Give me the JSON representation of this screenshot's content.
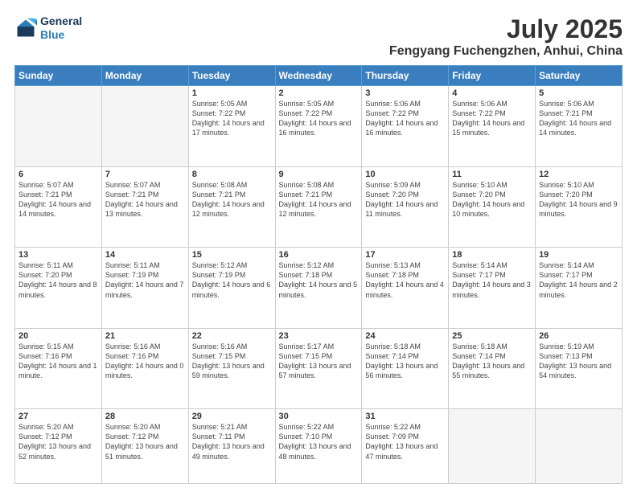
{
  "header": {
    "logo_line1": "General",
    "logo_line2": "Blue",
    "title": "July 2025",
    "subtitle": "Fengyang Fuchengzhen, Anhui, China"
  },
  "weekdays": [
    "Sunday",
    "Monday",
    "Tuesday",
    "Wednesday",
    "Thursday",
    "Friday",
    "Saturday"
  ],
  "weeks": [
    [
      {
        "day": "",
        "info": ""
      },
      {
        "day": "",
        "info": ""
      },
      {
        "day": "1",
        "info": "Sunrise: 5:05 AM\nSunset: 7:22 PM\nDaylight: 14 hours and 17 minutes."
      },
      {
        "day": "2",
        "info": "Sunrise: 5:05 AM\nSunset: 7:22 PM\nDaylight: 14 hours and 16 minutes."
      },
      {
        "day": "3",
        "info": "Sunrise: 5:06 AM\nSunset: 7:22 PM\nDaylight: 14 hours and 16 minutes."
      },
      {
        "day": "4",
        "info": "Sunrise: 5:06 AM\nSunset: 7:22 PM\nDaylight: 14 hours and 15 minutes."
      },
      {
        "day": "5",
        "info": "Sunrise: 5:06 AM\nSunset: 7:21 PM\nDaylight: 14 hours and 14 minutes."
      }
    ],
    [
      {
        "day": "6",
        "info": "Sunrise: 5:07 AM\nSunset: 7:21 PM\nDaylight: 14 hours and 14 minutes."
      },
      {
        "day": "7",
        "info": "Sunrise: 5:07 AM\nSunset: 7:21 PM\nDaylight: 14 hours and 13 minutes."
      },
      {
        "day": "8",
        "info": "Sunrise: 5:08 AM\nSunset: 7:21 PM\nDaylight: 14 hours and 12 minutes."
      },
      {
        "day": "9",
        "info": "Sunrise: 5:08 AM\nSunset: 7:21 PM\nDaylight: 14 hours and 12 minutes."
      },
      {
        "day": "10",
        "info": "Sunrise: 5:09 AM\nSunset: 7:20 PM\nDaylight: 14 hours and 11 minutes."
      },
      {
        "day": "11",
        "info": "Sunrise: 5:10 AM\nSunset: 7:20 PM\nDaylight: 14 hours and 10 minutes."
      },
      {
        "day": "12",
        "info": "Sunrise: 5:10 AM\nSunset: 7:20 PM\nDaylight: 14 hours and 9 minutes."
      }
    ],
    [
      {
        "day": "13",
        "info": "Sunrise: 5:11 AM\nSunset: 7:20 PM\nDaylight: 14 hours and 8 minutes."
      },
      {
        "day": "14",
        "info": "Sunrise: 5:11 AM\nSunset: 7:19 PM\nDaylight: 14 hours and 7 minutes."
      },
      {
        "day": "15",
        "info": "Sunrise: 5:12 AM\nSunset: 7:19 PM\nDaylight: 14 hours and 6 minutes."
      },
      {
        "day": "16",
        "info": "Sunrise: 5:12 AM\nSunset: 7:18 PM\nDaylight: 14 hours and 5 minutes."
      },
      {
        "day": "17",
        "info": "Sunrise: 5:13 AM\nSunset: 7:18 PM\nDaylight: 14 hours and 4 minutes."
      },
      {
        "day": "18",
        "info": "Sunrise: 5:14 AM\nSunset: 7:17 PM\nDaylight: 14 hours and 3 minutes."
      },
      {
        "day": "19",
        "info": "Sunrise: 5:14 AM\nSunset: 7:17 PM\nDaylight: 14 hours and 2 minutes."
      }
    ],
    [
      {
        "day": "20",
        "info": "Sunrise: 5:15 AM\nSunset: 7:16 PM\nDaylight: 14 hours and 1 minute."
      },
      {
        "day": "21",
        "info": "Sunrise: 5:16 AM\nSunset: 7:16 PM\nDaylight: 14 hours and 0 minutes."
      },
      {
        "day": "22",
        "info": "Sunrise: 5:16 AM\nSunset: 7:15 PM\nDaylight: 13 hours and 59 minutes."
      },
      {
        "day": "23",
        "info": "Sunrise: 5:17 AM\nSunset: 7:15 PM\nDaylight: 13 hours and 57 minutes."
      },
      {
        "day": "24",
        "info": "Sunrise: 5:18 AM\nSunset: 7:14 PM\nDaylight: 13 hours and 56 minutes."
      },
      {
        "day": "25",
        "info": "Sunrise: 5:18 AM\nSunset: 7:14 PM\nDaylight: 13 hours and 55 minutes."
      },
      {
        "day": "26",
        "info": "Sunrise: 5:19 AM\nSunset: 7:13 PM\nDaylight: 13 hours and 54 minutes."
      }
    ],
    [
      {
        "day": "27",
        "info": "Sunrise: 5:20 AM\nSunset: 7:12 PM\nDaylight: 13 hours and 52 minutes."
      },
      {
        "day": "28",
        "info": "Sunrise: 5:20 AM\nSunset: 7:12 PM\nDaylight: 13 hours and 51 minutes."
      },
      {
        "day": "29",
        "info": "Sunrise: 5:21 AM\nSunset: 7:11 PM\nDaylight: 13 hours and 49 minutes."
      },
      {
        "day": "30",
        "info": "Sunrise: 5:22 AM\nSunset: 7:10 PM\nDaylight: 13 hours and 48 minutes."
      },
      {
        "day": "31",
        "info": "Sunrise: 5:22 AM\nSunset: 7:09 PM\nDaylight: 13 hours and 47 minutes."
      },
      {
        "day": "",
        "info": ""
      },
      {
        "day": "",
        "info": ""
      }
    ]
  ]
}
